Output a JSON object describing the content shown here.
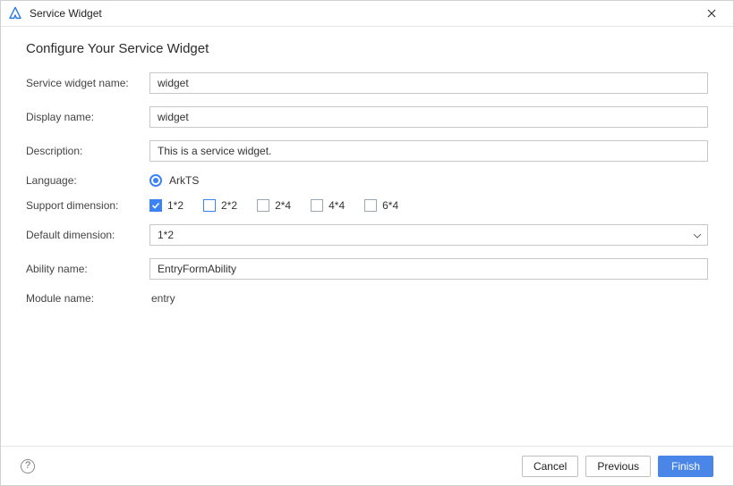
{
  "window": {
    "title": "Service Widget"
  },
  "page": {
    "heading": "Configure Your Service Widget"
  },
  "form": {
    "widget_name": {
      "label": "Service widget name:",
      "value": "widget"
    },
    "display_name": {
      "label": "Display name:",
      "value": "widget"
    },
    "description": {
      "label": "Description:",
      "value": "This is a service widget."
    },
    "language": {
      "label": "Language:",
      "options": [
        "ArkTS"
      ],
      "selected": "ArkTS"
    },
    "support_dimension": {
      "label": "Support dimension:",
      "options": [
        {
          "label": "1*2",
          "checked": true
        },
        {
          "label": "2*2",
          "checked": false,
          "outline_blue": true
        },
        {
          "label": "2*4",
          "checked": false
        },
        {
          "label": "4*4",
          "checked": false
        },
        {
          "label": "6*4",
          "checked": false
        }
      ]
    },
    "default_dimension": {
      "label": "Default dimension:",
      "value": "1*2"
    },
    "ability_name": {
      "label": "Ability name:",
      "value": "EntryFormAbility"
    },
    "module_name": {
      "label": "Module name:",
      "value": "entry"
    }
  },
  "footer": {
    "cancel": "Cancel",
    "previous": "Previous",
    "finish": "Finish"
  }
}
